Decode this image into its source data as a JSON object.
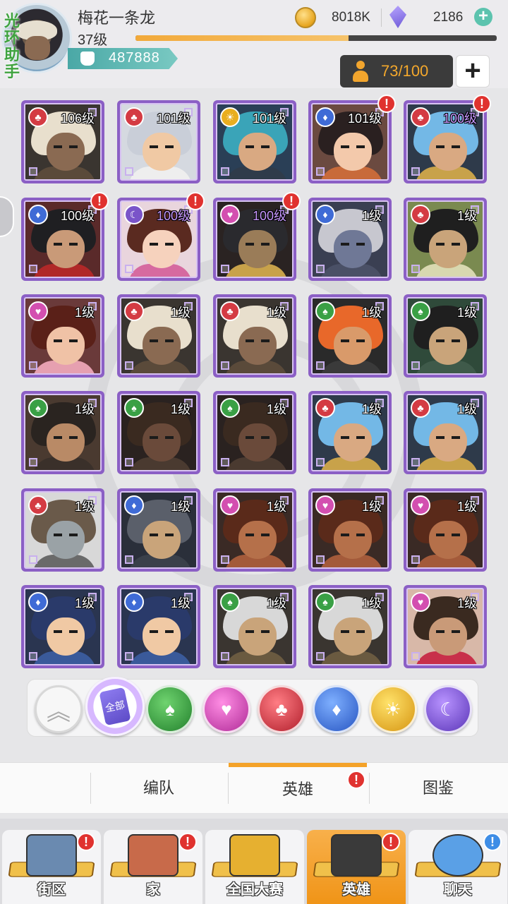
{
  "player": {
    "name": "梅花一条龙",
    "level": "37级",
    "xp_progress": 0.59,
    "power": "487888",
    "watermark": "光环助手"
  },
  "currency": {
    "gold": "8018K",
    "gems": "2186",
    "add_icon": "plus-icon"
  },
  "roster": {
    "count": "73/100",
    "add_label": "+"
  },
  "colors": {
    "frame": "#8b5fc5",
    "accent": "#f4a229",
    "alert": "#e0322f"
  },
  "heroes": [
    {
      "level": "106级",
      "element": "red",
      "alert": false,
      "purple": false,
      "hair": "#e8dfcd",
      "skin": "#8a6a52",
      "bg": "#3a3530",
      "cloth": "#5a4a3a"
    },
    {
      "level": "101级",
      "element": "red",
      "alert": false,
      "purple": false,
      "hair": "#c9ced8",
      "skin": "#f0c9a4",
      "bg": "#d5d9e0",
      "cloth": "#eeeeee"
    },
    {
      "level": "101级",
      "element": "sun",
      "alert": false,
      "purple": false,
      "hair": "#3aa4b8",
      "skin": "#d9a982",
      "bg": "#2a3f56",
      "cloth": "#2f3b4a"
    },
    {
      "level": "101级",
      "element": "blue",
      "alert": true,
      "purple": false,
      "hair": "#2a2020",
      "skin": "#f3c9ab",
      "bg": "#6b4a40",
      "cloth": "#c86a3a"
    },
    {
      "level": "100级",
      "element": "red",
      "alert": true,
      "purple": true,
      "hair": "#73b8e6",
      "skin": "#d9a982",
      "bg": "#2e3a4a",
      "cloth": "#c8a24a"
    },
    {
      "level": "100级",
      "element": "blue",
      "alert": true,
      "purple": false,
      "hair": "#1f1f22",
      "skin": "#c99a78",
      "bg": "#5a2a2a",
      "cloth": "#b02828"
    },
    {
      "level": "100级",
      "element": "purple",
      "alert": true,
      "purple": true,
      "hair": "#5a2a20",
      "skin": "#f6d2bd",
      "bg": "#e9d5dd",
      "cloth": "#d66aa0"
    },
    {
      "level": "100级",
      "element": "pink",
      "alert": true,
      "purple": true,
      "hair": "#2a2a2e",
      "skin": "#9a7c58",
      "bg": "#2a2322",
      "cloth": "#c8a24a"
    },
    {
      "level": "1级",
      "element": "blue",
      "alert": false,
      "purple": false,
      "hair": "#c7c7cf",
      "skin": "#6f7896",
      "bg": "#3a3f52",
      "cloth": "#4a5066"
    },
    {
      "level": "1级",
      "element": "red",
      "alert": false,
      "purple": false,
      "hair": "#1f1f1f",
      "skin": "#c9a47a",
      "bg": "#7a8a50",
      "cloth": "#d8d8b0"
    },
    {
      "level": "1级",
      "element": "pink",
      "alert": false,
      "purple": false,
      "hair": "#5a2018",
      "skin": "#f0c2a6",
      "bg": "#6a3a3a",
      "cloth": "#e6a0b0"
    },
    {
      "level": "1级",
      "element": "red",
      "alert": false,
      "purple": false,
      "hair": "#e8dfcd",
      "skin": "#8a6a52",
      "bg": "#3a3530",
      "cloth": "#5a4a3a"
    },
    {
      "level": "1级",
      "element": "red",
      "alert": false,
      "purple": false,
      "hair": "#e8dfcd",
      "skin": "#8a6a52",
      "bg": "#3a3530",
      "cloth": "#5a4a3a"
    },
    {
      "level": "1级",
      "element": "green",
      "alert": false,
      "purple": false,
      "hair": "#e8682a",
      "skin": "#d99a6a",
      "bg": "#2a2a2a",
      "cloth": "#3a3a3a"
    },
    {
      "level": "1级",
      "element": "green",
      "alert": false,
      "purple": false,
      "hair": "#1f1f1f",
      "skin": "#c9a47a",
      "bg": "#2f4a3a",
      "cloth": "#3f5a4a"
    },
    {
      "level": "1级",
      "element": "green",
      "alert": false,
      "purple": false,
      "hair": "#2a2420",
      "skin": "#b98a66",
      "bg": "#4a3a30",
      "cloth": "#3a302a"
    },
    {
      "level": "1级",
      "element": "green",
      "alert": false,
      "purple": false,
      "hair": "#3a2a20",
      "skin": "#6a4a3a",
      "bg": "#2a2220",
      "cloth": "#4a3a30"
    },
    {
      "level": "1级",
      "element": "green",
      "alert": false,
      "purple": false,
      "hair": "#3a2a20",
      "skin": "#6a4a3a",
      "bg": "#2a2220",
      "cloth": "#4a3a30"
    },
    {
      "level": "1级",
      "element": "red",
      "alert": false,
      "purple": false,
      "hair": "#73b8e6",
      "skin": "#d9a982",
      "bg": "#2e3a4a",
      "cloth": "#c8a24a"
    },
    {
      "level": "1级",
      "element": "red",
      "alert": false,
      "purple": false,
      "hair": "#73b8e6",
      "skin": "#d9a982",
      "bg": "#2e3a4a",
      "cloth": "#c8a24a"
    },
    {
      "level": "1级",
      "element": "red",
      "alert": false,
      "purple": false,
      "hair": "#6a5a4a",
      "skin": "#9aa2a6",
      "bg": "#d8d8d8",
      "cloth": "#6a6a6a"
    },
    {
      "level": "1级",
      "element": "blue",
      "alert": false,
      "purple": false,
      "hair": "#5a5f6a",
      "skin": "#c9a47a",
      "bg": "#2a2f3a",
      "cloth": "#3a404a"
    },
    {
      "level": "1级",
      "element": "pink",
      "alert": false,
      "purple": false,
      "hair": "#5a2a1a",
      "skin": "#b5704a",
      "bg": "#3a2a25",
      "cloth": "#a35a3a"
    },
    {
      "level": "1级",
      "element": "pink",
      "alert": false,
      "purple": false,
      "hair": "#5a2a1a",
      "skin": "#b5704a",
      "bg": "#3a2a25",
      "cloth": "#a35a3a"
    },
    {
      "level": "1级",
      "element": "pink",
      "alert": false,
      "purple": false,
      "hair": "#5a2a1a",
      "skin": "#b5704a",
      "bg": "#3a2a25",
      "cloth": "#a35a3a"
    },
    {
      "level": "1级",
      "element": "blue",
      "alert": false,
      "purple": false,
      "hair": "#2a3a6a",
      "skin": "#f0c9a4",
      "bg": "#2a3550",
      "cloth": "#3a5a9a"
    },
    {
      "level": "1级",
      "element": "blue",
      "alert": false,
      "purple": false,
      "hair": "#2a3a6a",
      "skin": "#f0c9a4",
      "bg": "#2a3550",
      "cloth": "#3a5a9a"
    },
    {
      "level": "1级",
      "element": "green",
      "alert": false,
      "purple": false,
      "hair": "#d8d8d8",
      "skin": "#c9a47a",
      "bg": "#3a3530",
      "cloth": "#6a5a40"
    },
    {
      "level": "1级",
      "element": "green",
      "alert": false,
      "purple": false,
      "hair": "#d8d8d8",
      "skin": "#c9a47a",
      "bg": "#3a3530",
      "cloth": "#6a5a40"
    },
    {
      "level": "1级",
      "element": "pink",
      "alert": false,
      "purple": false,
      "hair": "#3a2a20",
      "skin": "#c99a78",
      "bg": "#d8b8a8",
      "cloth": "#c8304a"
    }
  ],
  "filters": [
    {
      "name": "collapse",
      "icon": "chevron-up-icon",
      "glyph": "︽"
    },
    {
      "name": "all",
      "icon": "all-cards-icon",
      "label": "全部"
    },
    {
      "name": "green",
      "icon": "spade-icon",
      "glyph": "♠"
    },
    {
      "name": "pink",
      "icon": "heart-icon",
      "glyph": "♥"
    },
    {
      "name": "red",
      "icon": "club-icon",
      "glyph": "♣"
    },
    {
      "name": "blue",
      "icon": "diamond-icon",
      "glyph": "♦"
    },
    {
      "name": "sun",
      "icon": "sun-icon",
      "glyph": "☀"
    },
    {
      "name": "purple",
      "icon": "moon-icon",
      "glyph": "☾"
    }
  ],
  "sub_tabs": {
    "formation": "编队",
    "heroes": "英雄",
    "codex": "图鉴"
  },
  "nav": [
    {
      "label": "街区",
      "icon": "signpost-icon",
      "alert": "!",
      "alert_color": "red"
    },
    {
      "label": "家",
      "icon": "house-icon",
      "alert": "!",
      "alert_color": "red"
    },
    {
      "label": "全国大赛",
      "icon": "trophy-icon",
      "alert": "",
      "alert_color": ""
    },
    {
      "label": "英雄",
      "icon": "hero-cards-icon",
      "alert": "!",
      "alert_color": "red"
    },
    {
      "label": "聊天",
      "icon": "chat-bubble-icon",
      "alert": "!",
      "alert_color": "blue"
    }
  ]
}
